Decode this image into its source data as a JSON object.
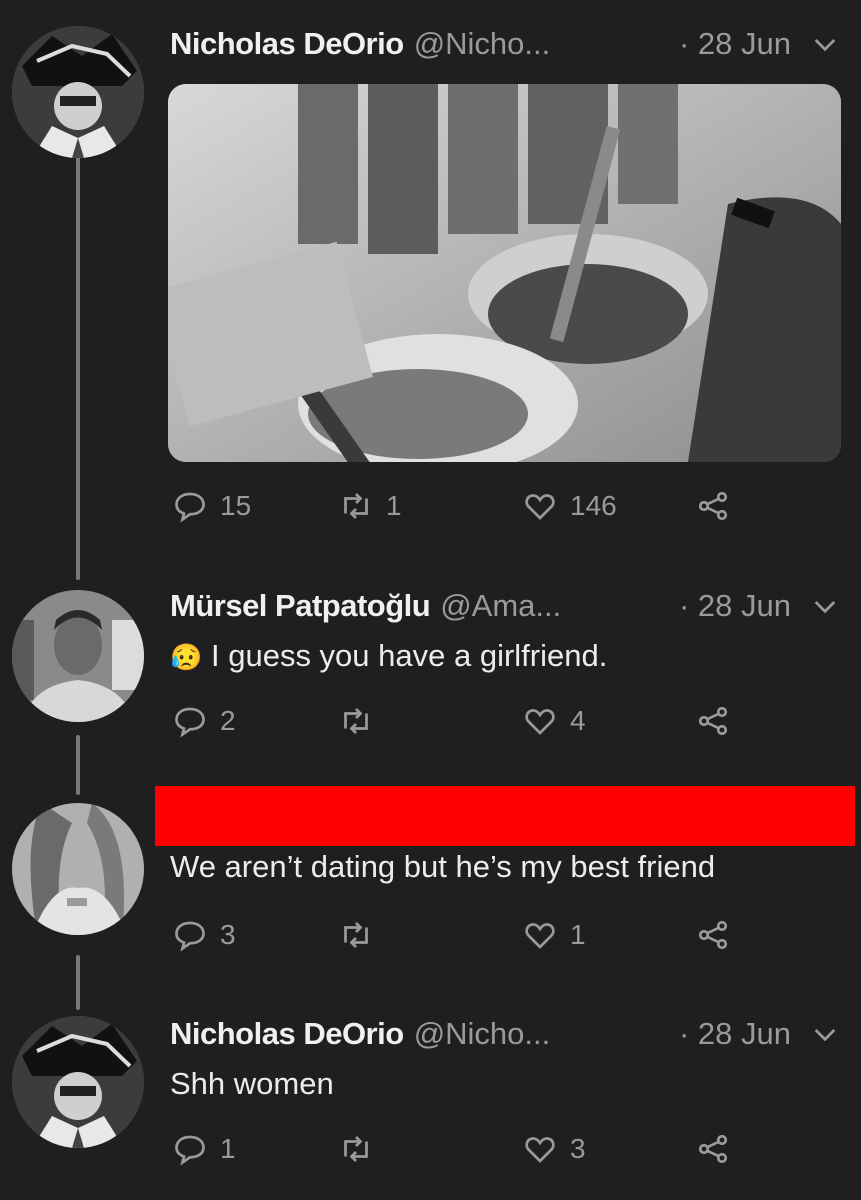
{
  "tweets": [
    {
      "name": "Nicholas DeOrio",
      "handle": "@Nicho...",
      "date": "· 28 Jun",
      "text": "",
      "replies": "15",
      "retweets": "1",
      "likes": "146"
    },
    {
      "name": "Mürsel Patpatoğlu",
      "handle": "@Ama...",
      "date": "· 28 Jun",
      "text": "I guess you have a girlfriend.",
      "emoji": "😥",
      "replies": "2",
      "retweets": "",
      "likes": "4"
    },
    {
      "name": "",
      "handle": "",
      "date": "",
      "text": "We aren’t dating but he’s my best friend",
      "replies": "3",
      "retweets": "",
      "likes": "1"
    },
    {
      "name": "Nicholas DeOrio",
      "handle": "@Nicho...",
      "date": "· 28 Jun",
      "text": "Shh women",
      "replies": "1",
      "retweets": "",
      "likes": "3"
    }
  ],
  "colors": {
    "background": "#1f1f21",
    "redaction": "#ff0000",
    "muted": "#9a9a9a"
  },
  "icons": [
    "reply-icon",
    "retweet-icon",
    "like-icon",
    "share-icon",
    "chevron-down-icon"
  ]
}
